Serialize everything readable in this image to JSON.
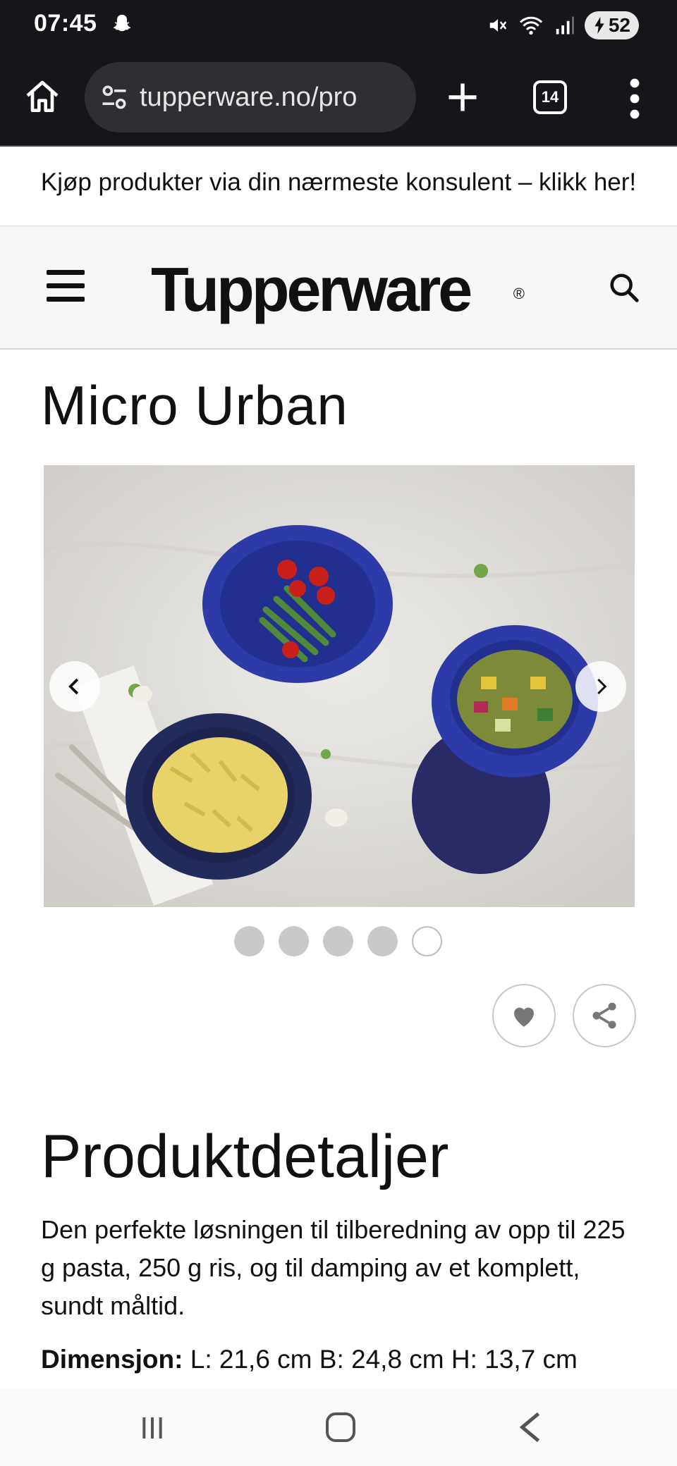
{
  "status_bar": {
    "time": "07:45",
    "battery_level": "52"
  },
  "browser": {
    "url": "tupperware.no/pro",
    "tab_count": "14"
  },
  "promo": {
    "text": "Kjøp produkter via din nærmeste konsulent – klikk her!",
    "chevron": "›"
  },
  "header": {
    "logo_text": "Tupperware",
    "logo_mark": "®"
  },
  "product": {
    "title": "Micro Urban",
    "gallery": {
      "image_count": 5,
      "active_index": 4
    }
  },
  "details": {
    "title": "Produktdetaljer",
    "description": "Den perfekte løsningen til tilberedning av opp til 225 g pasta, 250 g ris, og til damping av et komplett, sundt måltid.",
    "dimension_label": "Dimensjon:",
    "dimension_value": " L: 21,6 cm B: 24,8 cm H: 13,7 cm"
  },
  "colors": {
    "bar_dark": "#16161a",
    "container_blue": "#2d3aa8",
    "container_navy": "#2a2a66"
  }
}
